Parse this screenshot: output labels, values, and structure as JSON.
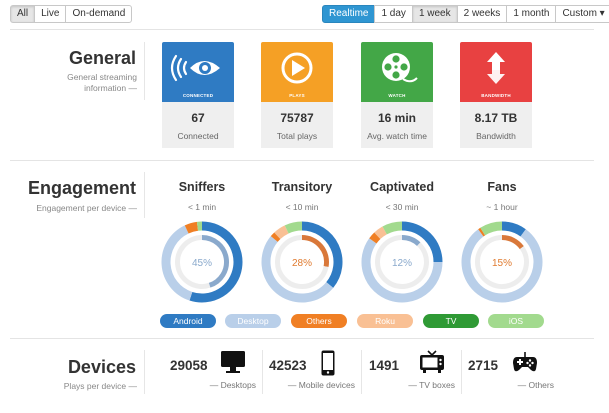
{
  "toolbar": {
    "left_buttons": [
      "All",
      "Live",
      "On-demand"
    ],
    "right_buttons": [
      "Realtime",
      "1 day",
      "1 week",
      "2 weeks",
      "1 month",
      "Custom ▾"
    ]
  },
  "general": {
    "title": "General",
    "subtitle_line1": "General streaming",
    "subtitle_line2": "information —",
    "cards": [
      {
        "tag": "CONNECTED",
        "value": "67",
        "label": "Connected",
        "color": "#2f7bc3",
        "icon": "broadcast-eye-icon"
      },
      {
        "tag": "PLAYS",
        "value": "75787",
        "label": "Total plays",
        "color": "#f5a025",
        "icon": "play-circle-icon"
      },
      {
        "tag": "WATCH",
        "value": "16 min",
        "label": "Avg. watch time",
        "color": "#43a747",
        "icon": "film-reel-icon"
      },
      {
        "tag": "BANDWIDTH",
        "value": "8.17 TB",
        "label": "Bandwidth",
        "color": "#e84141",
        "icon": "up-down-arrows-icon"
      }
    ]
  },
  "engagement": {
    "title": "Engagement",
    "subtitle": "Engagement per device —",
    "groups": [
      {
        "title": "Sniffers",
        "time": "< 1 min",
        "percent": "45%",
        "percent_color": "#8aa9cc",
        "outer": [
          0.55,
          0.38,
          0.05,
          0.0,
          0.0,
          0.02
        ],
        "inner": [
          0.45,
          0.55
        ]
      },
      {
        "title": "Transitory",
        "time": "< 10 min",
        "percent": "28%",
        "percent_color": "#e07b30",
        "outer": [
          0.36,
          0.5,
          0.02,
          0.05,
          0.0,
          0.07
        ],
        "inner": [
          0.28,
          0.72
        ]
      },
      {
        "title": "Captivated",
        "time": "< 30 min",
        "percent": "12%",
        "percent_color": "#8aa9cc",
        "outer": [
          0.25,
          0.6,
          0.03,
          0.04,
          0.0,
          0.08
        ],
        "inner": [
          0.12,
          0.88
        ]
      },
      {
        "title": "Fans",
        "time": "~ 1 hour",
        "percent": "15%",
        "percent_color": "#e07b30",
        "outer": [
          0.1,
          0.8,
          0.01,
          0.0,
          0.0,
          0.09
        ],
        "inner": [
          0.15,
          0.85
        ]
      }
    ],
    "legend": [
      {
        "label": "Android",
        "color": "#2f7bc3",
        "text_color": "#ffffff"
      },
      {
        "label": "Desktop",
        "color": "#b9cfe9",
        "text_color": "#ffffff"
      },
      {
        "label": "Others",
        "color": "#f07f24",
        "text_color": "#ffffff"
      },
      {
        "label": "Roku",
        "color": "#f9c094",
        "text_color": "#ffffff"
      },
      {
        "label": "TV",
        "color": "#2f9a35",
        "text_color": "#ffffff"
      },
      {
        "label": "iOS",
        "color": "#a2da8e",
        "text_color": "#ffffff"
      }
    ]
  },
  "devices": {
    "title": "Devices",
    "subtitle": "Plays per device —",
    "items": [
      {
        "count": "29058",
        "label": "— Desktops",
        "icon": "monitor-icon"
      },
      {
        "count": "42523",
        "label": "— Mobile devices",
        "icon": "smartphone-icon"
      },
      {
        "count": "1491",
        "label": "— TV boxes",
        "icon": "tv-icon"
      },
      {
        "count": "2715",
        "label": "— Others",
        "icon": "gamepad-icon"
      }
    ]
  }
}
